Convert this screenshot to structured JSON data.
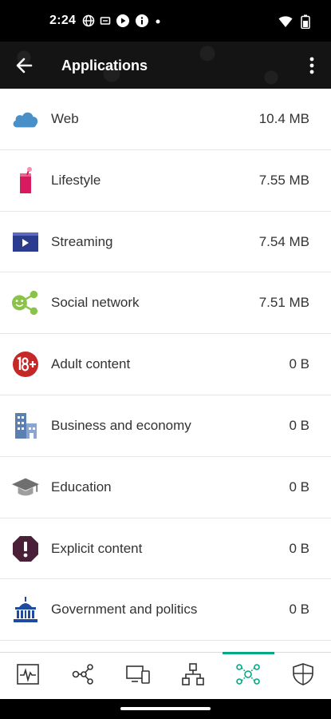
{
  "status_bar": {
    "time": "2:24"
  },
  "app_bar": {
    "title": "Applications"
  },
  "applications": [
    {
      "name": "Web",
      "size": "10.4 MB",
      "icon": "cloud-icon",
      "color": "#4a90c8"
    },
    {
      "name": "Lifestyle",
      "size": "7.55 MB",
      "icon": "drink-icon",
      "color": "#d81b60"
    },
    {
      "name": "Streaming",
      "size": "7.54 MB",
      "icon": "video-player-icon",
      "color": "#2b3c8f"
    },
    {
      "name": "Social network",
      "size": "7.51 MB",
      "icon": "social-share-icon",
      "color": "#8bc34a"
    },
    {
      "name": "Adult content",
      "size": "0 B",
      "icon": "adult-18-plus-icon",
      "color": "#c62828"
    },
    {
      "name": "Business and economy",
      "size": "0 B",
      "icon": "office-building-icon",
      "color": "#5b7fb3"
    },
    {
      "name": "Education",
      "size": "0 B",
      "icon": "graduation-cap-icon",
      "color": "#6f6f6f"
    },
    {
      "name": "Explicit content",
      "size": "0 B",
      "icon": "exclamation-octagon-icon",
      "color": "#4a2038"
    },
    {
      "name": "Government and politics",
      "size": "0 B",
      "icon": "capitol-building-icon",
      "color": "#1f4aa0"
    }
  ],
  "bottom_nav": {
    "items": [
      {
        "name": "activity-monitor-icon"
      },
      {
        "name": "network-nodes-icon"
      },
      {
        "name": "devices-icon"
      },
      {
        "name": "topology-icon"
      },
      {
        "name": "applications-icon",
        "active": true
      },
      {
        "name": "security-shield-icon"
      }
    ],
    "active_color": "#01a982"
  }
}
